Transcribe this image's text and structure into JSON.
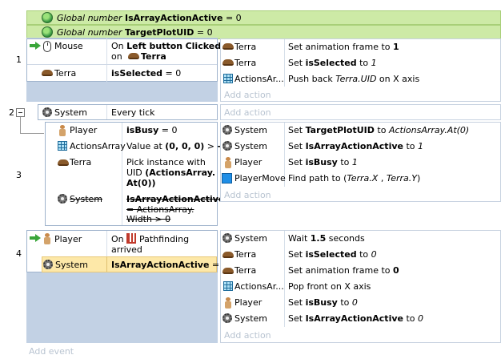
{
  "globals": [
    {
      "prefix": "Global number",
      "name": "IsArrayActionActive",
      "value": "= 0"
    },
    {
      "prefix": "Global number",
      "name": "TargetPlotUID",
      "value": "= 0"
    }
  ],
  "events": {
    "e1": {
      "number": "1",
      "conditions": [
        {
          "object": "Mouse",
          "text_a": "On ",
          "text_b": "Left button",
          "text_c": " ",
          "text_d": "Clicked",
          "text_e": "on ",
          "text_f": "Terra"
        },
        {
          "object": "Terra",
          "text_a": "isSelected",
          "text_b": " = 0"
        }
      ],
      "actions": [
        {
          "object": "Terra",
          "text_a": "Set animation frame to ",
          "text_b": "1"
        },
        {
          "object": "Terra",
          "text_a": "Set ",
          "text_b": "isSelected",
          "text_c": " to ",
          "text_d": "1"
        },
        {
          "object": "ActionsAr...",
          "text_a": "Push back ",
          "text_b": "Terra.UID",
          "text_c": "  on X axis"
        }
      ],
      "add_action": "Add action"
    },
    "e2": {
      "number": "2",
      "conditions": [
        {
          "object": "System",
          "text_a": "Every tick"
        }
      ],
      "add_action": "Add action"
    },
    "e3": {
      "number": "3",
      "conditions": [
        {
          "object": "Player",
          "text_a": "isBusy",
          "text_b": " = 0"
        },
        {
          "object": "ActionsArray",
          "text_a": "Value at ",
          "text_b": "(0, 0, 0)",
          "text_c": " > ",
          "text_d": "-1"
        },
        {
          "object": "Terra",
          "line1": "Pick instance with",
          "line2_a": "UID  ",
          "line2_b": "(ActionsArray.",
          "line3": "At(0))"
        },
        {
          "object": "System",
          "line1": "IsArrayActionActive",
          "line2": "= ActionsArray.",
          "line3": "Width > 0"
        }
      ],
      "actions": [
        {
          "object": "System",
          "text_a": "Set ",
          "text_b": "TargetPlotUID",
          "text_c": " to ",
          "text_d": "ActionsArray.At(0)"
        },
        {
          "object": "System",
          "text_a": "Set ",
          "text_b": "IsArrayActionActive",
          "text_c": " to ",
          "text_d": "1"
        },
        {
          "object": "Player",
          "text_a": "Set ",
          "text_b": "isBusy",
          "text_c": " to ",
          "text_d": "1"
        },
        {
          "object": "PlayerMove",
          "text_a": "Find path to (",
          "text_b": "Terra.X",
          "text_c": " , ",
          "text_d": "Terra.Y",
          "text_e": ")"
        }
      ],
      "add_action": "Add action"
    },
    "e4": {
      "number": "4",
      "conditions": [
        {
          "object": "Player",
          "text_a": "On ",
          "text_b": "Pathfinding",
          "text_c": "arrived"
        },
        {
          "object": "System",
          "text_a": "IsArrayActionActive",
          "text_b": " = 1"
        }
      ],
      "actions": [
        {
          "object": "System",
          "text_a": "Wait ",
          "text_b": "1.5",
          "text_c": " seconds"
        },
        {
          "object": "Terra",
          "text_a": "Set ",
          "text_b": "isSelected",
          "text_c": " to ",
          "text_d": "0"
        },
        {
          "object": "Terra",
          "text_a": "Set animation frame to ",
          "text_b": "0"
        },
        {
          "object": "ActionsAr...",
          "text_a": "Pop front on X axis"
        },
        {
          "object": "Player",
          "text_a": "Set ",
          "text_b": "isBusy",
          "text_c": " to ",
          "text_d": "0"
        },
        {
          "object": "System",
          "text_a": "Set ",
          "text_b": "IsArrayActionActive",
          "text_c": " to ",
          "text_d": "0"
        }
      ],
      "add_action": "Add action"
    }
  },
  "add_event": "Add event",
  "colors": {
    "global_bg": "#cdeaa6",
    "event_panel": "#c2d1e4",
    "highlight": "#fde8a8",
    "add_text": "#b9c4d1"
  },
  "icons": [
    "globe-icon",
    "mouse-icon",
    "terra-icon",
    "gear-icon",
    "grid-icon",
    "player-icon",
    "path-icon",
    "arrow-icon",
    "bluesquare-icon"
  ]
}
